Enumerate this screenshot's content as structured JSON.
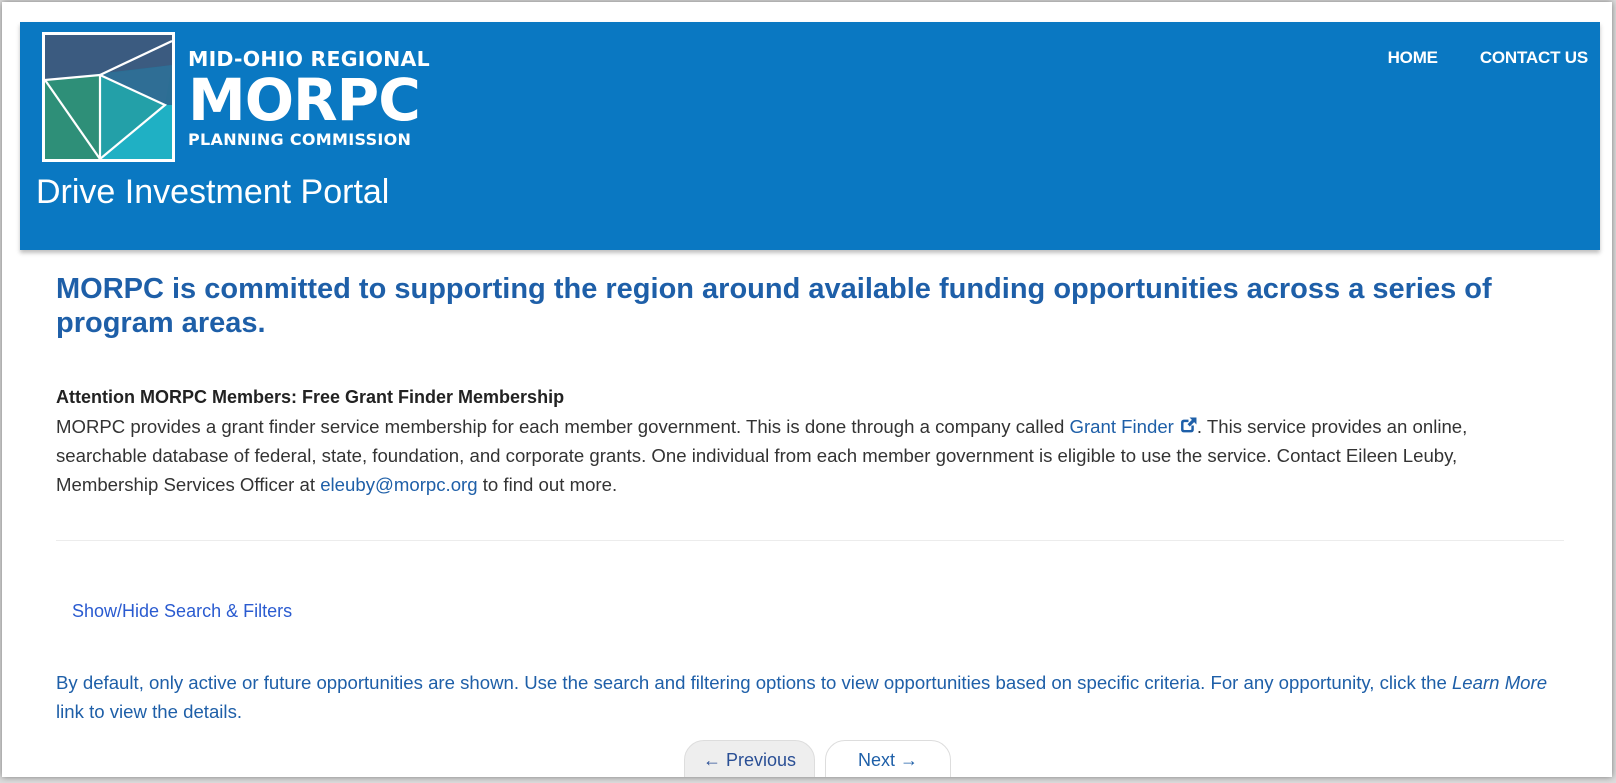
{
  "header": {
    "logo": {
      "line1": "MID-OHIO REGIONAL",
      "line2": "MORPC",
      "line3": "PLANNING COMMISSION"
    },
    "portal_title": "Drive Investment Portal",
    "nav": {
      "home": "HOME",
      "contact": "CONTACT US"
    }
  },
  "main": {
    "headline": "MORPC is committed to supporting the region around available funding opportunities across a series of program areas.",
    "attention": {
      "heading": "Attention MORPC Members: Free Grant Finder Membership",
      "text_before_link": "MORPC provides a grant finder service membership for each member government. This is done through a company called ",
      "grant_finder_link": "Grant Finder",
      "text_after_link": ". This service provides an online, searchable database of federal, state, foundation, and corporate grants. One individual from each member government is eligible to use the service. Contact Eileen Leuby, Membership Services Officer at ",
      "email_link": "eleuby@morpc.org",
      "text_end": " to find out more."
    },
    "toggle_filters": "Show/Hide Search & Filters",
    "default_note": {
      "before": "By default, only active or future opportunities are shown. Use the search and filtering options to view opportunities based on specific criteria. For any opportunity, click the ",
      "emphasis": "Learn More",
      "after": " link to view the details."
    },
    "pager": {
      "previous": "← Previous",
      "next": "Next →"
    }
  },
  "colors": {
    "header_bg": "#0a78c2",
    "headline": "#1e5fa8",
    "link": "#1e5fa8",
    "filter_link": "#2a5bd0"
  },
  "icons": {
    "external_link": "external-link-icon"
  }
}
